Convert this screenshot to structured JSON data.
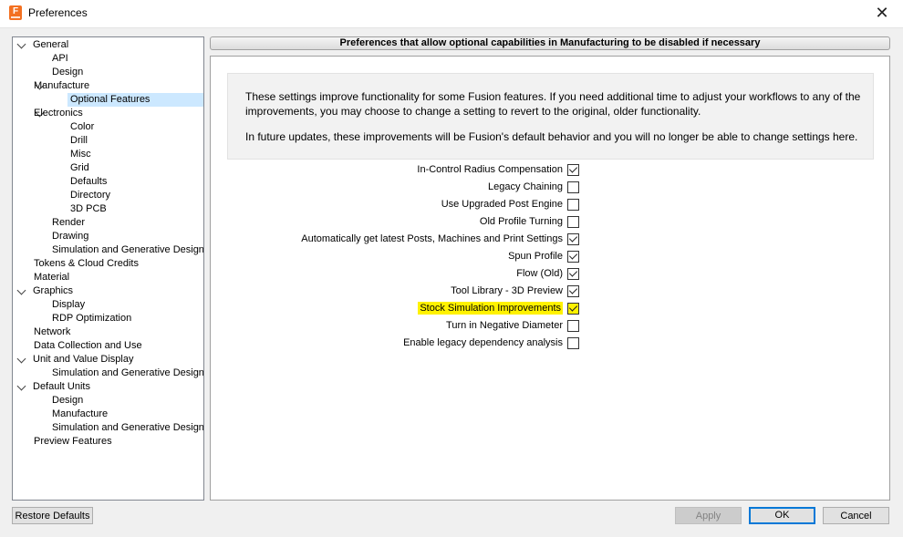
{
  "window": {
    "title": "Preferences",
    "close_glyph": "✕",
    "app_icon_letter": "F",
    "app_icon_color": "#f37021"
  },
  "tree": [
    {
      "label": "General",
      "level": 0,
      "expanded": true
    },
    {
      "label": "API",
      "level": 2
    },
    {
      "label": "Design",
      "level": 2
    },
    {
      "label": "Manufacture",
      "level": 1,
      "expanded": true
    },
    {
      "label": "Optional Features",
      "level": 3,
      "selected": true
    },
    {
      "label": "Electronics",
      "level": 1,
      "expanded": true
    },
    {
      "label": "Color",
      "level": 3
    },
    {
      "label": "Drill",
      "level": 3
    },
    {
      "label": "Misc",
      "level": 3
    },
    {
      "label": "Grid",
      "level": 3
    },
    {
      "label": "Defaults",
      "level": 3
    },
    {
      "label": "Directory",
      "level": 3
    },
    {
      "label": "3D PCB",
      "level": 3
    },
    {
      "label": "Render",
      "level": 2
    },
    {
      "label": "Drawing",
      "level": 2
    },
    {
      "label": "Simulation and Generative Design",
      "level": 2
    },
    {
      "label": "Tokens & Cloud Credits",
      "level": 1
    },
    {
      "label": "Material",
      "level": 1
    },
    {
      "label": "Graphics",
      "level": 0,
      "expanded": true
    },
    {
      "label": "Display",
      "level": 2
    },
    {
      "label": "RDP Optimization",
      "level": 2
    },
    {
      "label": "Network",
      "level": 1
    },
    {
      "label": "Data Collection and Use",
      "level": 1
    },
    {
      "label": "Unit and Value Display",
      "level": 0,
      "expanded": true
    },
    {
      "label": "Simulation and Generative Design",
      "level": 2
    },
    {
      "label": "Default Units",
      "level": 0,
      "expanded": true
    },
    {
      "label": "Design",
      "level": 2
    },
    {
      "label": "Manufacture",
      "level": 2
    },
    {
      "label": "Simulation and Generative Design",
      "level": 2
    },
    {
      "label": "Preview Features",
      "level": 1
    }
  ],
  "header": {
    "title": "Preferences that allow optional capabilities in Manufacturing to be disabled if necessary"
  },
  "info": {
    "paragraph1": "These settings improve functionality for some Fusion features. If you need additional time to adjust your workflows to any of the improvements, you may choose to change a setting to revert to the original, older functionality.",
    "paragraph2": "In future updates, these improvements will be Fusion's default behavior and you will no longer be able to change settings here."
  },
  "options": [
    {
      "label": "In-Control Radius Compensation",
      "checked": true
    },
    {
      "label": "Legacy Chaining",
      "checked": false
    },
    {
      "label": "Use Upgraded Post Engine",
      "checked": false
    },
    {
      "label": "Old Profile Turning",
      "checked": false
    },
    {
      "label": "Automatically get latest Posts, Machines and Print Settings",
      "checked": true
    },
    {
      "label": "Spun Profile",
      "checked": true
    },
    {
      "label": "Flow (Old)",
      "checked": true
    },
    {
      "label": "Tool Library - 3D Preview",
      "checked": true
    },
    {
      "label": "Stock Simulation Improvements",
      "checked": true,
      "highlighted": true
    },
    {
      "label": "Turn in Negative Diameter",
      "checked": false
    },
    {
      "label": "Enable legacy dependency analysis",
      "checked": false
    }
  ],
  "buttons": {
    "restore_defaults": "Restore Defaults",
    "apply": "Apply",
    "ok": "OK",
    "cancel": "Cancel"
  },
  "colors": {
    "highlight": "#fff200",
    "selection": "#cce8ff",
    "focus_border": "#0078d7"
  }
}
